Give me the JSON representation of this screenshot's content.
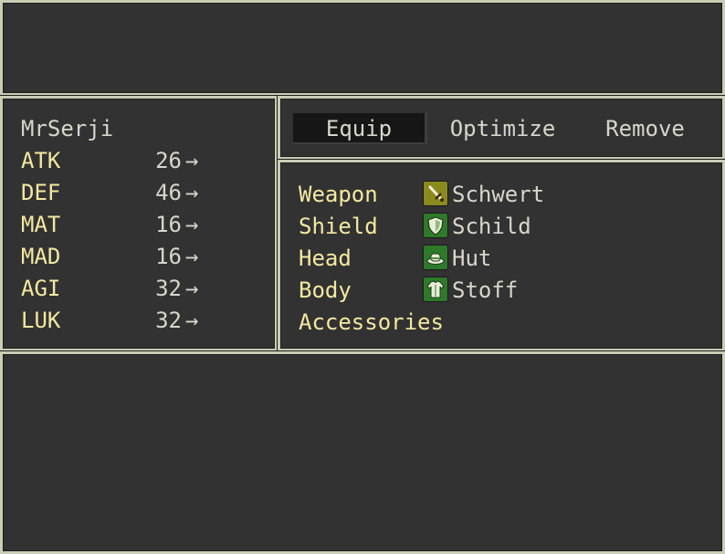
{
  "actor": {
    "name": "MrSerji",
    "stats": [
      {
        "label": "ATK",
        "value": "26"
      },
      {
        "label": "DEF",
        "value": "46"
      },
      {
        "label": "MAT",
        "value": "16"
      },
      {
        "label": "MAD",
        "value": "16"
      },
      {
        "label": "AGI",
        "value": "32"
      },
      {
        "label": "LUK",
        "value": "32"
      }
    ],
    "arrow": "→"
  },
  "commands": {
    "equip": "Equip",
    "optimize": "Optimize",
    "remove": "Remove",
    "selected": "equip"
  },
  "slots": [
    {
      "label": "Weapon",
      "item": "Schwert",
      "icon": "sword-icon",
      "icon_color": "#8a8a1e"
    },
    {
      "label": "Shield",
      "item": "Schild",
      "icon": "shield-icon",
      "icon_color": "#2f7a2a"
    },
    {
      "label": "Head",
      "item": "Hut",
      "icon": "hat-icon",
      "icon_color": "#2f7a2a"
    },
    {
      "label": "Body",
      "item": "Stoff",
      "icon": "cloth-armor-icon",
      "icon_color": "#2f7a2a"
    },
    {
      "label": "Accessories",
      "item": "",
      "icon": "",
      "icon_color": ""
    }
  ],
  "colors": {
    "window_bg": "#323232",
    "border": "#c9cdb4",
    "system_text": "#f2e9a2",
    "normal_text": "#d6d6cc"
  }
}
